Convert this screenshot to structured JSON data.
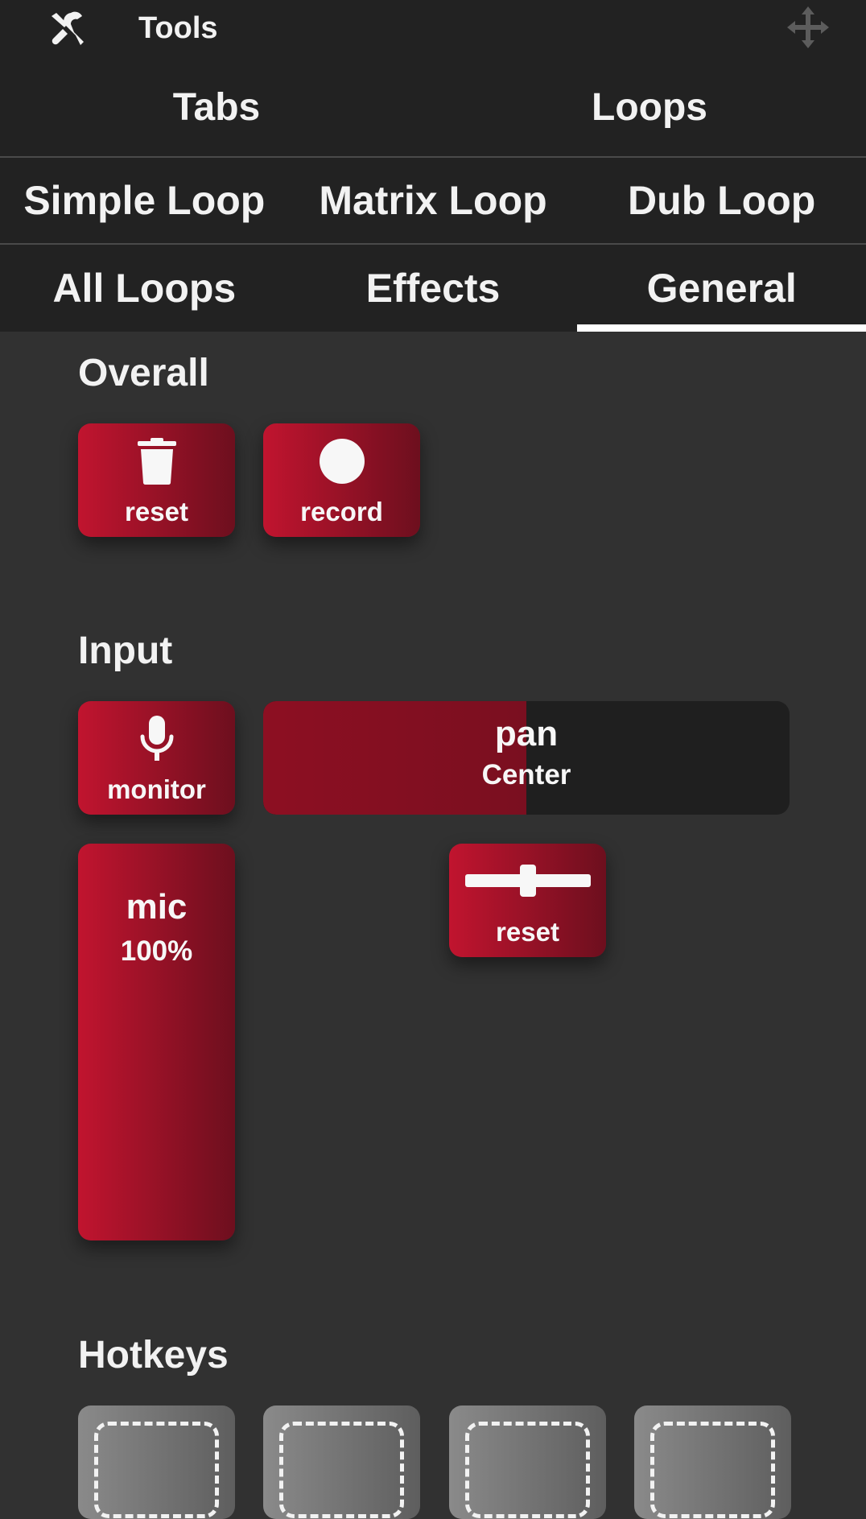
{
  "header": {
    "title": "Tools",
    "tools_icon": "tools-icon",
    "move_icon": "move-icon"
  },
  "tabs": {
    "row1": [
      "Tabs",
      "Loops"
    ],
    "row2": [
      "Simple Loop",
      "Matrix Loop",
      "Dub Loop"
    ],
    "row3": [
      "All Loops",
      "Effects",
      "General"
    ],
    "active": "General"
  },
  "overall": {
    "title": "Overall",
    "reset_label": "reset",
    "reset_icon": "trash-icon",
    "record_label": "record",
    "record_icon": "record-icon"
  },
  "input": {
    "title": "Input",
    "monitor_label": "monitor",
    "monitor_icon": "microphone-icon",
    "pan": {
      "label": "pan",
      "value": "Center",
      "level": 0.5
    },
    "mic": {
      "label": "mic",
      "value": "100%"
    },
    "pan_reset_label": "reset",
    "pan_reset_icon": "slider-icon"
  },
  "hotkeys": {
    "title": "Hotkeys",
    "count_visible": 4,
    "icon": "empty-slot-icon"
  },
  "colors": {
    "accent_start": "#c1142f",
    "accent_end": "#6d0f1e",
    "background": "#313131",
    "bar": "#222222"
  }
}
